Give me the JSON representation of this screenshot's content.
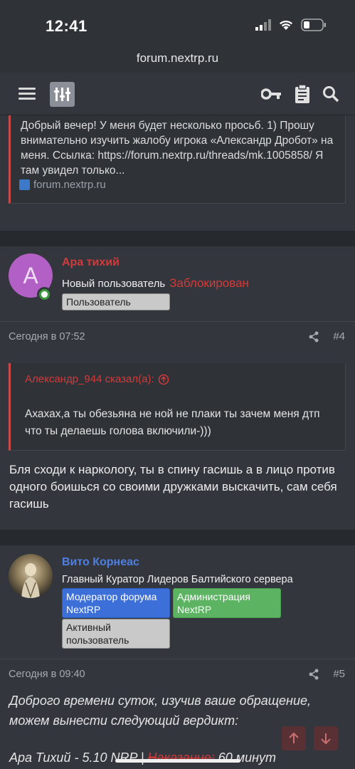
{
  "status_bar": {
    "time": "12:41"
  },
  "url_bar": {
    "url": "forum.nextrp.ru"
  },
  "nav": {
    "hamburger": "menu-icon",
    "logo": "nextrp-logo-icon",
    "key": "key-icon",
    "clipboard": "clipboard-icon",
    "search": "search-icon"
  },
  "top_unfurl": {
    "text": "Добрый вечер! У меня будет несколько просьб. 1) Прошу внимательно изучить жалобу игрока «Александр Дробот» на меня. Ссылка: https://forum.nextrp.ru/threads/mk.1005858/ Я там увидел только...",
    "link": "forum.nextrp.ru"
  },
  "post4": {
    "avatar_letter": "A",
    "username": "Ара тихий",
    "user_title": "Новый пользователь",
    "banned": "Заблокирован",
    "badges": [
      "Пользователь"
    ],
    "date": "Сегодня в 07:52",
    "number": "#4",
    "quote_author": "Александр_944 сказал(а):",
    "quote_text": "Ахахах,а ты обезьяна не ной не плаки ты зачем меня дтп что ты делаешь голова включили-)))",
    "message": "Бля сходи к наркологу, ты в спину гасишь а в лицо против одного боишься со своими дружками выскачить, сам себя гасишь"
  },
  "post5": {
    "username": "Вито Корнеас",
    "user_title": "Главный Куратор Лидеров Балтийского сервера",
    "badges": [
      "Модератор форума NextRP",
      "Администрация NextRP",
      "Активный пользователь"
    ],
    "date": "Сегодня в 09:40",
    "number": "#5",
    "message_line1": "Доброго времени суток, изучив ваше обращение, можем вынести следующий вердикт:",
    "verdict_prefix": "Ара Тихий - 5.10 NRP | ",
    "verdict_strike": "Наказание:",
    "verdict_suffix": " 60 минут"
  },
  "colors": {
    "banned": "#d23a3a",
    "username5": "#4f7fe0",
    "username4": "#d23a3a",
    "quote_border": "#c94a4a"
  }
}
